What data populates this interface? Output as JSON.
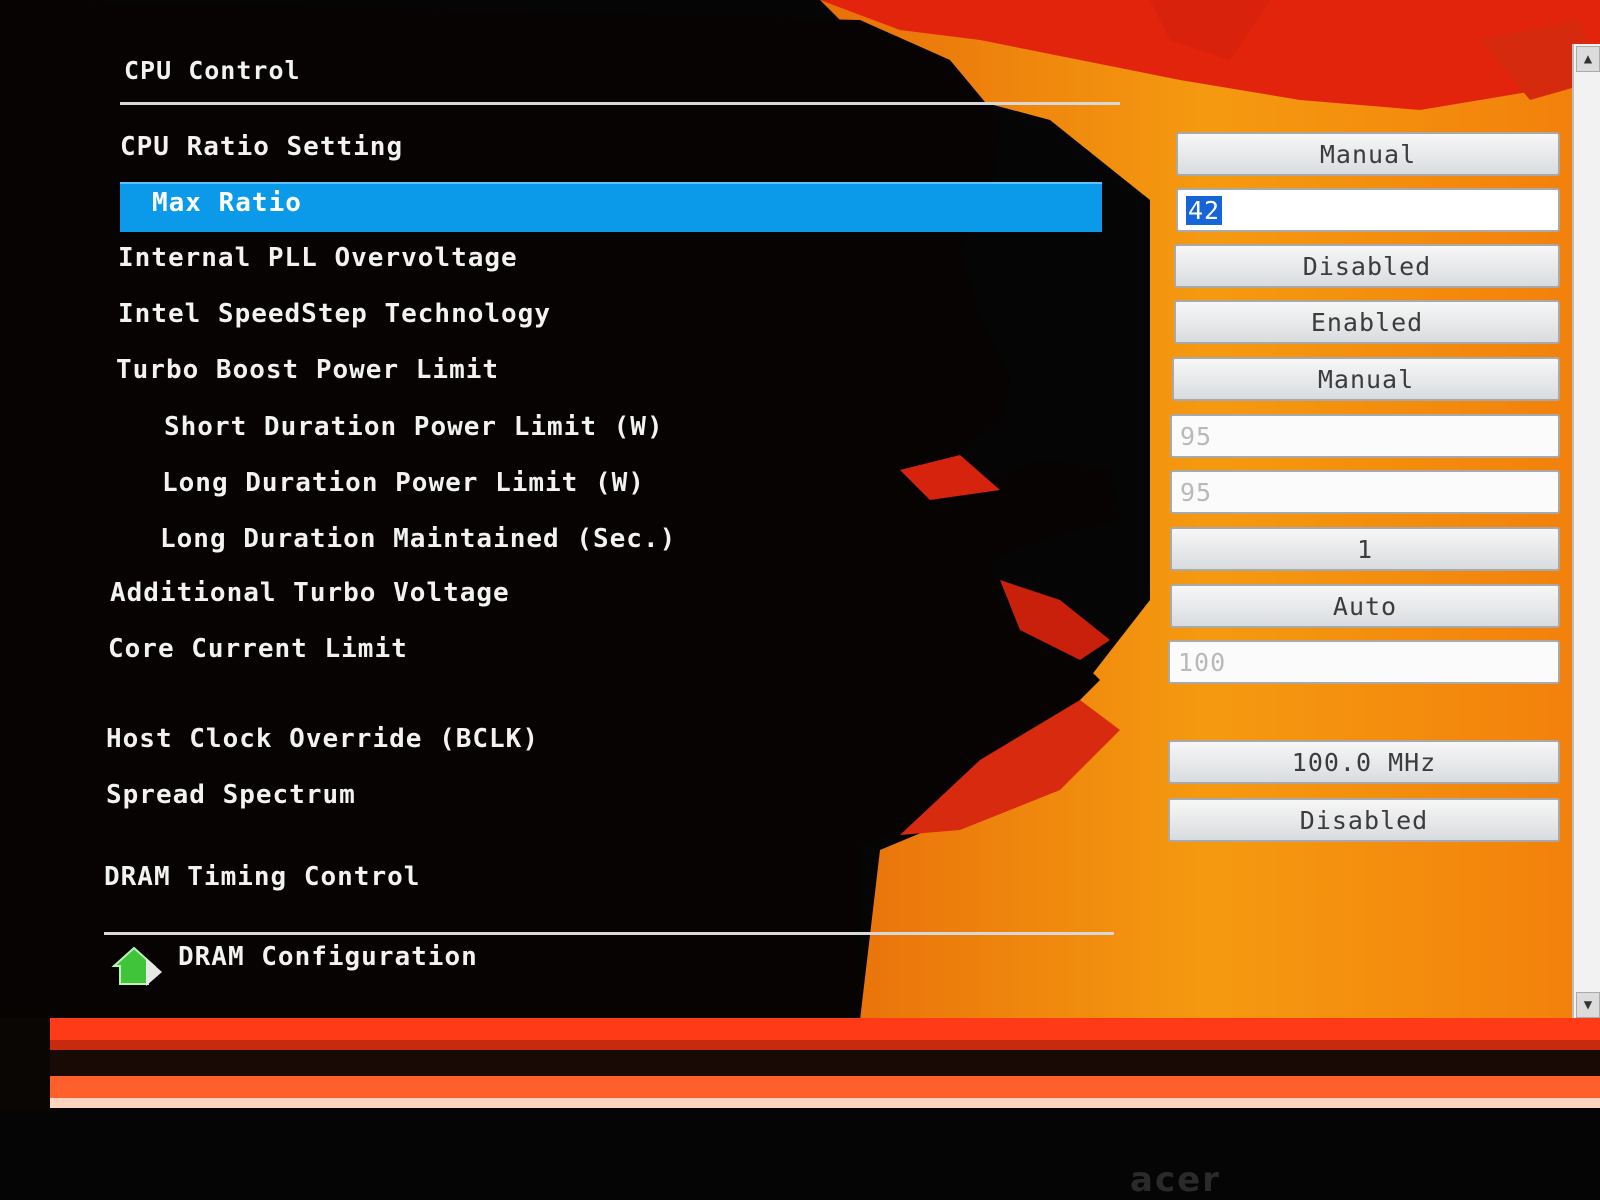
{
  "colors": {
    "background": "#050505",
    "art_orange": "#f28a0c",
    "art_red": "#e2240d",
    "selection": "#0a9ae9",
    "text": "#f2f2f2"
  },
  "section": {
    "title": "CPU Control"
  },
  "settings": [
    {
      "label": "CPU Ratio Setting",
      "value": "Manual",
      "type": "select"
    },
    {
      "label": "Max Ratio",
      "value": "42",
      "type": "input",
      "selected": true
    },
    {
      "label": "Internal PLL Overvoltage",
      "value": "Disabled",
      "type": "select"
    },
    {
      "label": "Intel SpeedStep Technology",
      "value": "Enabled",
      "type": "select"
    },
    {
      "label": "Turbo Boost Power Limit",
      "value": "Manual",
      "type": "select"
    },
    {
      "label": "Short Duration Power Limit (W)",
      "value": "95",
      "type": "input"
    },
    {
      "label": "Long Duration Power Limit (W)",
      "value": "95",
      "type": "input"
    },
    {
      "label": "Long Duration Maintained (Sec.)",
      "value": "1",
      "type": "select"
    },
    {
      "label": "Additional Turbo Voltage",
      "value": "Auto",
      "type": "select"
    },
    {
      "label": "Core Current Limit",
      "value": "100",
      "type": "input"
    },
    {
      "label": "Host Clock Override (BCLK)",
      "value": "100.0 MHz",
      "type": "select"
    },
    {
      "label": "Spread Spectrum",
      "value": "Disabled",
      "type": "select"
    }
  ],
  "dram": {
    "title": "DRAM Timing Control",
    "link_label": "DRAM Configuration",
    "icon": "green-house-arrow-icon"
  },
  "monitor": {
    "brand": "acer"
  }
}
